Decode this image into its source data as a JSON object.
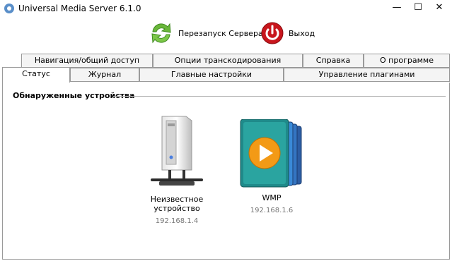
{
  "window": {
    "title": "Universal Media Server 6.1.0",
    "minimize": "—",
    "maximize": "☐",
    "close": "✕"
  },
  "toolbar": {
    "restart_label": "Перезапуск Сервера",
    "exit_label": "Выход"
  },
  "tabs_top": [
    "Навигация/общий доступ",
    "Опции транскодирования",
    "Справка",
    "О программе"
  ],
  "tabs_bottom": [
    "Статус",
    "Журнал",
    "Главные настройки",
    "Управление плагинами"
  ],
  "active_tab": "Статус",
  "status": {
    "section_title": "Обнаруженные устройства",
    "devices": [
      {
        "name": "Неизвестное устройство",
        "ip": "192.168.1.4",
        "icon": "pc-tower-icon"
      },
      {
        "name": "WMP",
        "ip": "192.168.1.6",
        "icon": "windows-media-player-icon"
      }
    ]
  },
  "colors": {
    "restart_green": "#6ab73a",
    "exit_red": "#c8161d",
    "wmp_orange": "#f39a16",
    "wmp_teal": "#1f8a8a"
  }
}
